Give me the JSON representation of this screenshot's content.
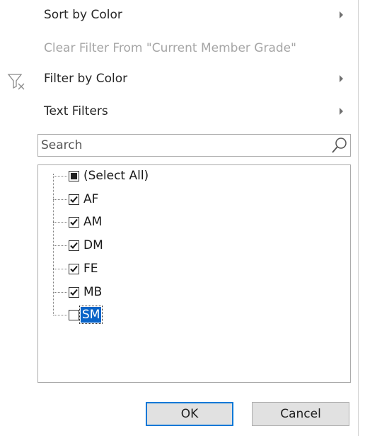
{
  "menu": {
    "sort_by_color": "Sort by Color",
    "clear_filter": "Clear Filter From \"Current Member Grade\"",
    "filter_by_color": "Filter by Color",
    "text_filters": "Text Filters"
  },
  "search": {
    "placeholder": "Search"
  },
  "tree": {
    "items": [
      {
        "label": "(Select All)",
        "state": "indeterminate"
      },
      {
        "label": "AF",
        "state": "checked"
      },
      {
        "label": "AM",
        "state": "checked"
      },
      {
        "label": "DM",
        "state": "checked"
      },
      {
        "label": "FE",
        "state": "checked"
      },
      {
        "label": "MB",
        "state": "checked"
      },
      {
        "label": "SM",
        "state": "unchecked",
        "selected": true
      }
    ]
  },
  "buttons": {
    "ok": "OK",
    "cancel": "Cancel"
  },
  "colors": {
    "selection": "#0a64c8",
    "disabled_text": "#a6a6a6",
    "ok_border": "#0078d7"
  },
  "icons": {
    "clear_filter": "funnel-clear-icon",
    "search": "magnifier-icon",
    "submenu": "chevron-right-icon",
    "checked": "checkmark-icon"
  }
}
